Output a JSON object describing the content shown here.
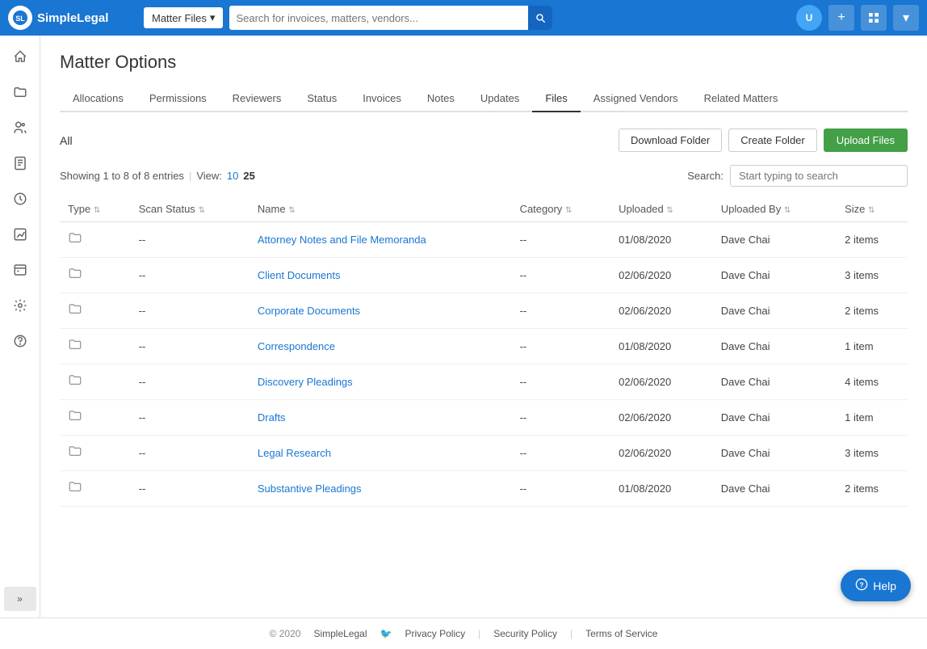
{
  "app": {
    "name": "SimpleLegal",
    "logo_initials": "SL"
  },
  "topnav": {
    "matter_files_label": "Matter Files",
    "search_placeholder": "Search for invoices, matters, vendors...",
    "dropdown_arrow": "▾"
  },
  "sidebar": {
    "items": [
      {
        "id": "home",
        "icon": "⌂",
        "label": "Home"
      },
      {
        "id": "matters",
        "icon": "📁",
        "label": "Matters"
      },
      {
        "id": "vendors",
        "icon": "👥",
        "label": "Vendors"
      },
      {
        "id": "invoices",
        "icon": "📄",
        "label": "Invoices"
      },
      {
        "id": "time",
        "icon": "⏱",
        "label": "Time"
      },
      {
        "id": "reports",
        "icon": "📊",
        "label": "Reports"
      },
      {
        "id": "ebilling",
        "icon": "📋",
        "label": "eBilling"
      },
      {
        "id": "settings",
        "icon": "⚙",
        "label": "Settings"
      },
      {
        "id": "help",
        "icon": "?",
        "label": "Help"
      }
    ],
    "expand_label": "«»"
  },
  "page": {
    "title": "Matter Options"
  },
  "tabs": [
    {
      "id": "allocations",
      "label": "Allocations",
      "active": false
    },
    {
      "id": "permissions",
      "label": "Permissions",
      "active": false
    },
    {
      "id": "reviewers",
      "label": "Reviewers",
      "active": false
    },
    {
      "id": "status",
      "label": "Status",
      "active": false
    },
    {
      "id": "invoices",
      "label": "Invoices",
      "active": false
    },
    {
      "id": "notes",
      "label": "Notes",
      "active": false
    },
    {
      "id": "updates",
      "label": "Updates",
      "active": false
    },
    {
      "id": "files",
      "label": "Files",
      "active": true
    },
    {
      "id": "assigned-vendors",
      "label": "Assigned Vendors",
      "active": false
    },
    {
      "id": "related-matters",
      "label": "Related Matters",
      "active": false
    }
  ],
  "files": {
    "section_label": "All",
    "download_folder_btn": "Download Folder",
    "create_folder_btn": "Create Folder",
    "upload_files_btn": "Upload Files",
    "showing_text": "Showing 1 to 8 of 8 entries",
    "view_label": "View:",
    "view_10": "10",
    "view_25": "25",
    "search_label": "Search:",
    "search_placeholder": "Start typing to search",
    "columns": [
      {
        "id": "type",
        "label": "Type"
      },
      {
        "id": "scan_status",
        "label": "Scan Status"
      },
      {
        "id": "name",
        "label": "Name"
      },
      {
        "id": "category",
        "label": "Category"
      },
      {
        "id": "uploaded",
        "label": "Uploaded"
      },
      {
        "id": "uploaded_by",
        "label": "Uploaded By"
      },
      {
        "id": "size",
        "label": "Size"
      }
    ],
    "rows": [
      {
        "type": "folder",
        "scan_status": "--",
        "name": "Attorney Notes and File Memoranda",
        "category": "--",
        "uploaded": "01/08/2020",
        "uploaded_by": "Dave Chai",
        "size": "2 items"
      },
      {
        "type": "folder",
        "scan_status": "--",
        "name": "Client Documents",
        "category": "--",
        "uploaded": "02/06/2020",
        "uploaded_by": "Dave Chai",
        "size": "3 items"
      },
      {
        "type": "folder",
        "scan_status": "--",
        "name": "Corporate Documents",
        "category": "--",
        "uploaded": "02/06/2020",
        "uploaded_by": "Dave Chai",
        "size": "2 items"
      },
      {
        "type": "folder",
        "scan_status": "--",
        "name": "Correspondence",
        "category": "--",
        "uploaded": "01/08/2020",
        "uploaded_by": "Dave Chai",
        "size": "1 item"
      },
      {
        "type": "folder",
        "scan_status": "--",
        "name": "Discovery Pleadings",
        "category": "--",
        "uploaded": "02/06/2020",
        "uploaded_by": "Dave Chai",
        "size": "4 items"
      },
      {
        "type": "folder",
        "scan_status": "--",
        "name": "Drafts",
        "category": "--",
        "uploaded": "02/06/2020",
        "uploaded_by": "Dave Chai",
        "size": "1 item"
      },
      {
        "type": "folder",
        "scan_status": "--",
        "name": "Legal Research",
        "category": "--",
        "uploaded": "02/06/2020",
        "uploaded_by": "Dave Chai",
        "size": "3 items"
      },
      {
        "type": "folder",
        "scan_status": "--",
        "name": "Substantive Pleadings",
        "category": "--",
        "uploaded": "01/08/2020",
        "uploaded_by": "Dave Chai",
        "size": "2 items"
      }
    ]
  },
  "footer": {
    "copyright": "© 2020",
    "brand": "SimpleLegal",
    "twitter_icon": "🐦",
    "privacy_policy": "Privacy Policy",
    "security_policy": "Security Policy",
    "terms": "Terms of Service"
  },
  "help": {
    "label": "Help"
  }
}
